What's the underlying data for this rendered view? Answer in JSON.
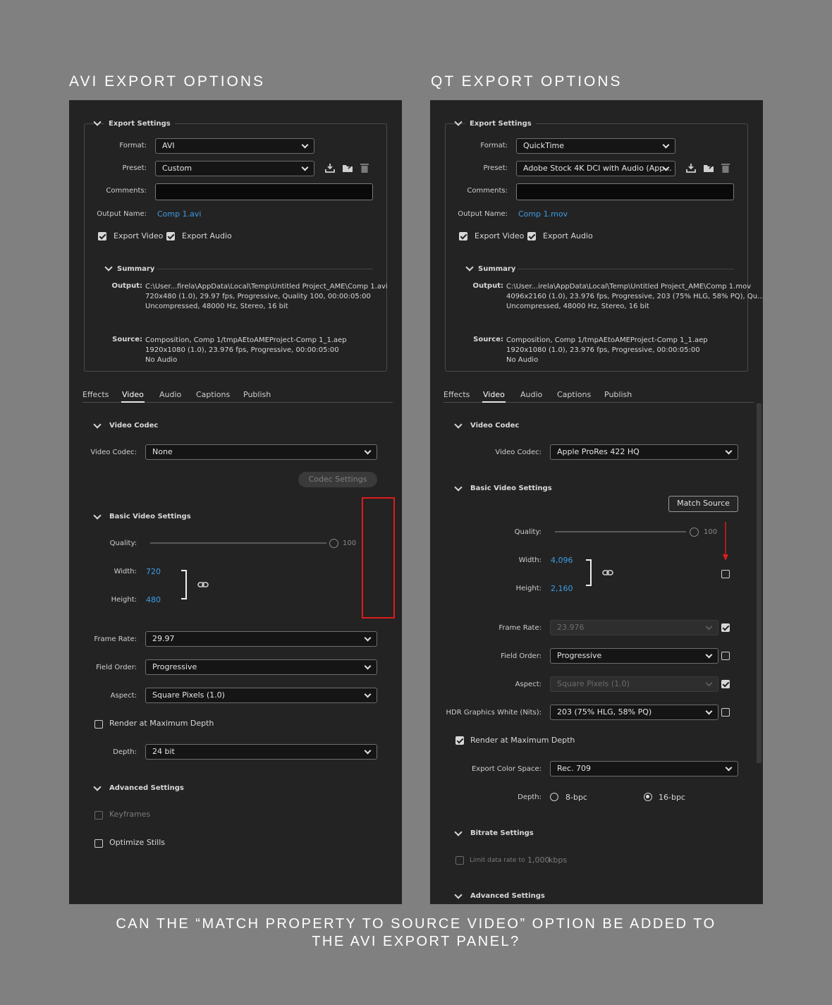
{
  "headings": {
    "avi": "AVI EXPORT OPTIONS",
    "qt": "QT EXPORT OPTIONS"
  },
  "footer": {
    "line1": "CAN THE “MATCH PROPERTY TO SOURCE VIDEO” OPTION BE ADDED TO",
    "line2": "THE AVI EXPORT PANEL?"
  },
  "colors": {
    "background": "#808080",
    "panel": "#232323",
    "link": "#3d9de6",
    "highlight": "#e01b1b"
  },
  "common": {
    "export_settings": "Export Settings",
    "format_label": "Format:",
    "preset_label": "Preset:",
    "comments_label": "Comments:",
    "output_name_label": "Output Name:",
    "export_video": "Export Video",
    "export_audio": "Export Audio",
    "summary": "Summary",
    "output_label": "Output:",
    "source_label": "Source:",
    "tabs": [
      "Effects",
      "Video",
      "Audio",
      "Captions",
      "Publish"
    ],
    "video_codec_section": "Video Codec",
    "video_codec_label": "Video Codec:",
    "basic_video_settings": "Basic Video Settings",
    "quality_label": "Quality:",
    "quality_value": "100",
    "width_label": "Width:",
    "height_label": "Height:",
    "frame_rate_label": "Frame Rate:",
    "field_order_label": "Field Order:",
    "aspect_label": "Aspect:",
    "render_max_depth": "Render at Maximum Depth",
    "depth_label": "Depth:",
    "advanced_settings": "Advanced Settings",
    "icons": {
      "save_preset": "download-icon",
      "import_preset": "folder-import-icon",
      "delete_preset": "trash-icon",
      "link": "chain-link-icon"
    }
  },
  "avi": {
    "format": "AVI",
    "preset": "Custom",
    "output_name": "Comp 1.avi",
    "export_video_checked": true,
    "export_audio_checked": true,
    "summary_output": [
      "C:\\User...firela\\AppData\\Local\\Temp\\Untitled Project_AME\\Comp 1.avi",
      "720x480 (1.0), 29.97 fps, Progressive, Quality 100, 00:00:05:00",
      "Uncompressed, 48000 Hz, Stereo, 16 bit"
    ],
    "summary_source": [
      "Composition, Comp 1/tmpAEtoAMEProject-Comp 1_1.aep",
      "1920x1080 (1.0), 23.976 fps, Progressive, 00:00:05:00",
      "No Audio"
    ],
    "video_codec": "None",
    "codec_settings_button": "Codec Settings",
    "width": "720",
    "height": "480",
    "frame_rate": "29.97",
    "field_order": "Progressive",
    "aspect": "Square Pixels (1.0)",
    "render_max_depth_checked": false,
    "depth": "24 bit",
    "keyframes": "Keyframes",
    "optimize_stills": "Optimize Stills"
  },
  "qt": {
    "format": "QuickTime",
    "preset": "Adobe Stock 4K DCI with Audio (App...",
    "output_name": "Comp 1.mov",
    "export_video_checked": true,
    "export_audio_checked": true,
    "summary_output": [
      "C:\\User...irela\\AppData\\Local\\Temp\\Untitled Project_AME\\Comp 1.mov",
      "4096x2160 (1.0), 23.976 fps, Progressive, 203 (75% HLG, 58% PQ), Qu...",
      "Uncompressed, 48000 Hz, Stereo, 16 bit"
    ],
    "summary_source": [
      "Composition, Comp 1/tmpAEtoAMEProject-Comp 1_1.aep",
      "1920x1080 (1.0), 23.976 fps, Progressive, 00:00:05:00",
      "No Audio"
    ],
    "video_codec": "Apple ProRes 422 HQ",
    "match_source_button": "Match Source",
    "width": "4,096",
    "height": "2,160",
    "frame_rate": "23.976",
    "field_order": "Progressive",
    "aspect": "Square Pixels (1.0)",
    "hdr_label": "HDR Graphics White (Nits):",
    "hdr_value": "203 (75% HLG, 58% PQ)",
    "render_max_depth_checked": true,
    "export_color_space_label": "Export Color Space:",
    "export_color_space": "Rec. 709",
    "depth_options": [
      "8-bpc",
      "16-bpc"
    ],
    "depth_selected": "16-bpc",
    "bitrate_settings": "Bitrate Settings",
    "limit_data_rate": "Limit data rate to",
    "limit_data_rate_value": "1,000",
    "limit_data_rate_unit": "kbps",
    "match_checkboxes": {
      "size": false,
      "frame_rate": true,
      "field_order": false,
      "aspect": true,
      "hdr": false
    }
  }
}
